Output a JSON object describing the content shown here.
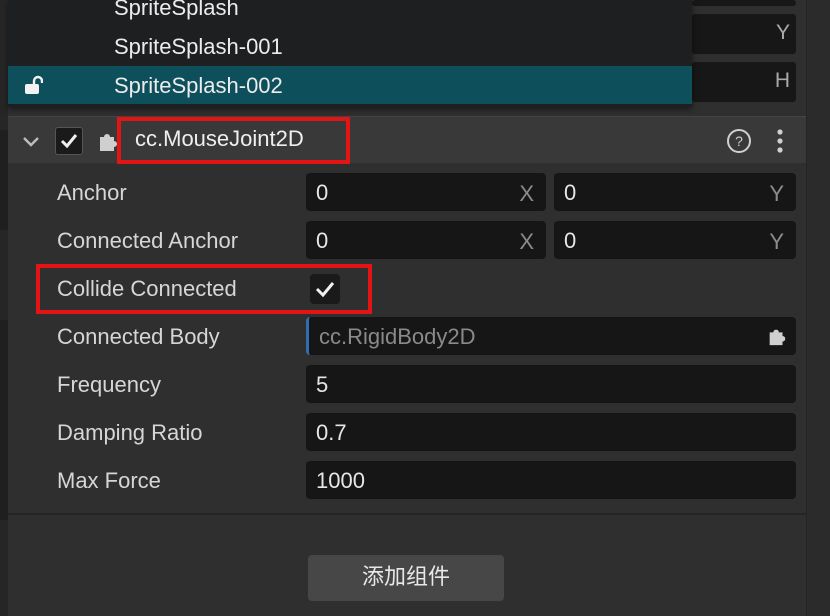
{
  "dropdown": {
    "items": [
      {
        "label": "SpriteSplash"
      },
      {
        "label": "SpriteSplash-001"
      },
      {
        "label": "SpriteSplash-002"
      }
    ]
  },
  "background_fields": {
    "axis_y": "Y",
    "axis_h": "H"
  },
  "component": {
    "title": "cc.MouseJoint2D",
    "enabled": true
  },
  "properties": {
    "anchor": {
      "label": "Anchor",
      "x": "0",
      "x_axis": "X",
      "y": "0",
      "y_axis": "Y"
    },
    "connected_anchor": {
      "label": "Connected Anchor",
      "x": "0",
      "x_axis": "X",
      "y": "0",
      "y_axis": "Y"
    },
    "collide_connected": {
      "label": "Collide Connected",
      "checked": true
    },
    "connected_body": {
      "label": "Connected Body",
      "value": "cc.RigidBody2D"
    },
    "frequency": {
      "label": "Frequency",
      "value": "5"
    },
    "damping_ratio": {
      "label": "Damping Ratio",
      "value": "0.7"
    },
    "max_force": {
      "label": "Max Force",
      "value": "1000"
    }
  },
  "add_component": {
    "label": "添加组件"
  },
  "colors": {
    "selected_row": "#0e4f5c",
    "highlight": "#e21414",
    "field_bg": "#161616"
  },
  "icons": [
    "unlock-icon",
    "chevron-down-icon",
    "checkbox-icon",
    "puzzle-icon",
    "help-icon",
    "more-vertical-icon"
  ]
}
